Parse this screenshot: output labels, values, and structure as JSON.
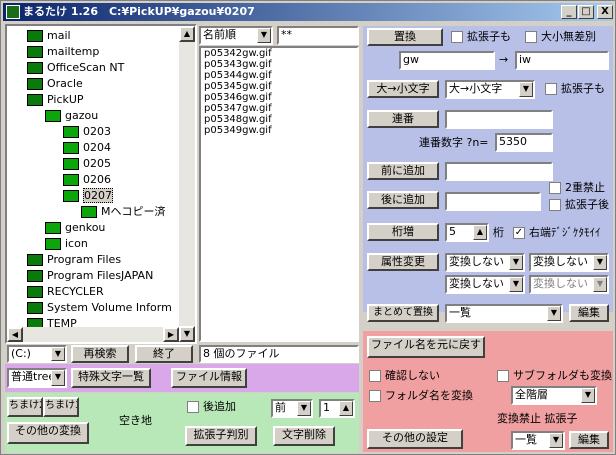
{
  "window": {
    "title": "まるたけ 1.26　C:¥PickUP¥gazou¥0207",
    "min_label": "_",
    "max_label": "□",
    "close_label": "X"
  },
  "tree": {
    "items": [
      {
        "label": "mail",
        "indent": 0
      },
      {
        "label": "mailtemp",
        "indent": 0
      },
      {
        "label": "OfficeScan NT",
        "indent": 0
      },
      {
        "label": "Oracle",
        "indent": 0
      },
      {
        "label": "PickUP",
        "indent": 0
      },
      {
        "label": "gazou",
        "indent": 1
      },
      {
        "label": "0203",
        "indent": 2
      },
      {
        "label": "0204",
        "indent": 2
      },
      {
        "label": "0205",
        "indent": 2
      },
      {
        "label": "0206",
        "indent": 2
      },
      {
        "label": "0207",
        "indent": 2
      },
      {
        "label": "Mヘコピー済",
        "indent": 3
      },
      {
        "label": "genkou",
        "indent": 1
      },
      {
        "label": "icon",
        "indent": 1
      },
      {
        "label": "Program Files",
        "indent": 0
      },
      {
        "label": "Program FilesJAPAN",
        "indent": 0
      },
      {
        "label": "RECYCLER",
        "indent": 0
      },
      {
        "label": "System Volume Inform",
        "indent": 0
      },
      {
        "label": "TEMP",
        "indent": 0
      }
    ]
  },
  "sort": {
    "value": "名前順"
  },
  "filter": {
    "value": "**"
  },
  "files": [
    "p05342gw.gif",
    "p05343gw.gif",
    "p05344gw.gif",
    "p05345gw.gif",
    "p05346gw.gif",
    "p05347gw.gif",
    "p05348gw.gif",
    "p05349gw.gif"
  ],
  "drive": {
    "value": "(C:)"
  },
  "buttons": {
    "research": "再検索",
    "exit": "終了",
    "special_list": "特殊文字一覧",
    "file_info": "ファイル情報",
    "replace": "置換",
    "case": "大→小文字",
    "serial": "連番",
    "prepend": "前に追加",
    "append": "後に追加",
    "digits": "桁増",
    "attr": "属性変更",
    "bulk_replace": "まとめて置換",
    "edit": "編集",
    "restore": "ファイル名を元に戻す",
    "other_settings": "その他の設定",
    "edit2": "編集",
    "other_convert": "その他の変換",
    "ext_detect": "拡張子判別",
    "char_delete": "文字削除",
    "slot1": "ちまけ2",
    "slot2": "ちまけ3"
  },
  "file_count": "8 個のファイル",
  "tree_mode": {
    "value": "普通tree"
  },
  "replace": {
    "ext_label": "拡張子も",
    "case_label": "大小無差別",
    "from": "gw",
    "arrow": "→",
    "to": "iw"
  },
  "case": {
    "mode": "大→小文字",
    "ext_label": "拡張子も"
  },
  "serial": {
    "value": "",
    "label": "連番数字 ?n=",
    "number": "5350"
  },
  "prepend": {
    "value": ""
  },
  "append": {
    "value": "",
    "dup_label": "2重禁止",
    "ext_after": "拡張子後"
  },
  "digits": {
    "value": "5",
    "unit": "桁",
    "right_label": "右端ﾃﾞｼﾞｹﾀﾓｲｲ"
  },
  "attr": {
    "a1": "変換しない",
    "a2": "変換しない",
    "a3": "変換しない",
    "a4": "変換しない"
  },
  "bulk": {
    "value": "一覧"
  },
  "pink": {
    "confirm_label": "確認しない",
    "folder_label": "フォルダ名を変換",
    "subfolder_label": "サブフォルダも変換",
    "depth": "全階層",
    "prohibit_label": "変換禁止 拡張子",
    "list_value": "一覧"
  },
  "green": {
    "empty_label": "空き地",
    "append_label": "後追加",
    "pos": "前",
    "count": "1"
  }
}
